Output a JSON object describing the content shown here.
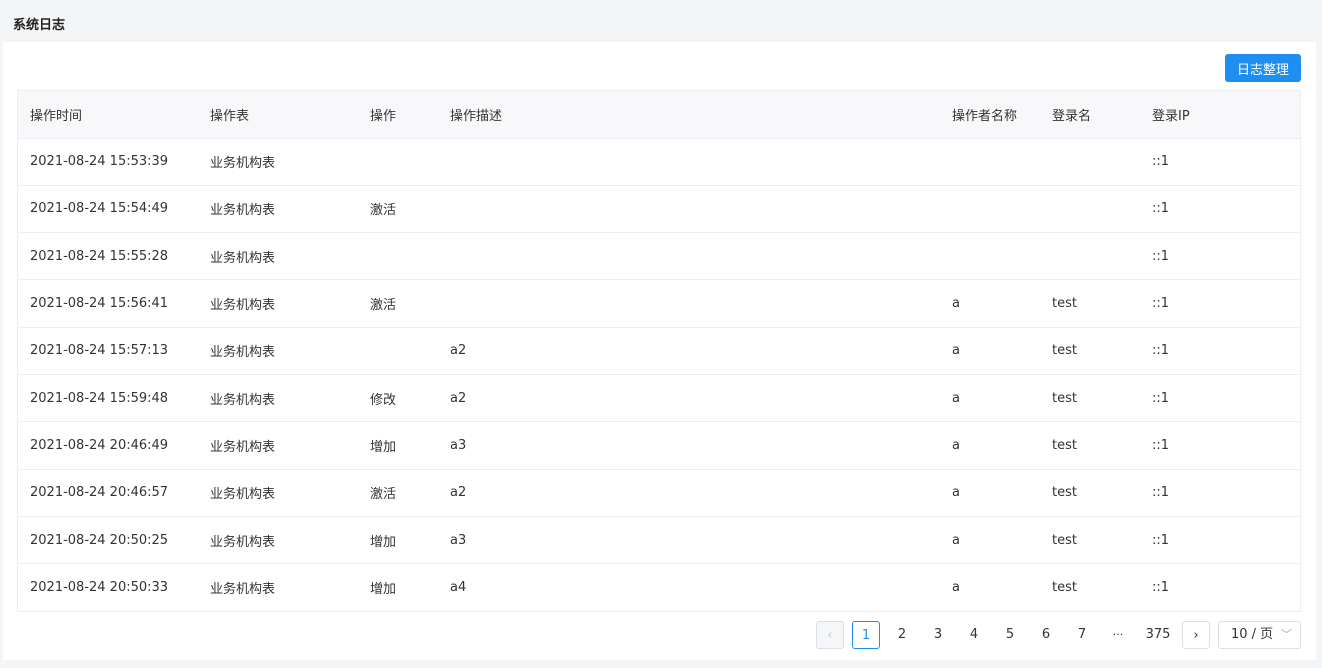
{
  "header": {
    "title": "系统日志"
  },
  "toolbar": {
    "tidy_label": "日志整理"
  },
  "table": {
    "columns": [
      "操作时间",
      "操作表",
      "操作",
      "操作描述",
      "操作者名称",
      "登录名",
      "登录IP"
    ],
    "rows": [
      [
        "2021-08-24 15:53:39",
        "业务机构表",
        "",
        "",
        "",
        "",
        "::1"
      ],
      [
        "2021-08-24 15:54:49",
        "业务机构表",
        "激活",
        "",
        "",
        "",
        "::1"
      ],
      [
        "2021-08-24 15:55:28",
        "业务机构表",
        "",
        "",
        "",
        "",
        "::1"
      ],
      [
        "2021-08-24 15:56:41",
        "业务机构表",
        "激活",
        "",
        "a",
        "test",
        "::1"
      ],
      [
        "2021-08-24 15:57:13",
        "业务机构表",
        "",
        "a2",
        "a",
        "test",
        "::1"
      ],
      [
        "2021-08-24 15:59:48",
        "业务机构表",
        "修改",
        "a2",
        "a",
        "test",
        "::1"
      ],
      [
        "2021-08-24 20:46:49",
        "业务机构表",
        "增加",
        "a3",
        "a",
        "test",
        "::1"
      ],
      [
        "2021-08-24 20:46:57",
        "业务机构表",
        "激活",
        "a2",
        "a",
        "test",
        "::1"
      ],
      [
        "2021-08-24 20:50:25",
        "业务机构表",
        "增加",
        "a3",
        "a",
        "test",
        "::1"
      ],
      [
        "2021-08-24 20:50:33",
        "业务机构表",
        "增加",
        "a4",
        "a",
        "test",
        "::1"
      ]
    ]
  },
  "pagination": {
    "pages": [
      "1",
      "2",
      "3",
      "4",
      "5",
      "6",
      "7"
    ],
    "ellipsis": "···",
    "last_page": "375",
    "current": "1",
    "page_size": "10 / 页"
  },
  "colors": {
    "accent": "#1f8ef1"
  }
}
